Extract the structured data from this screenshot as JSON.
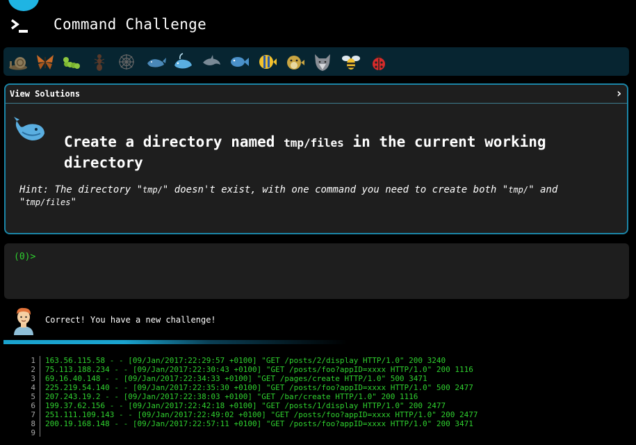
{
  "app": {
    "title": "Command Challenge"
  },
  "levels": [
    {
      "icon": "snail-icon"
    },
    {
      "icon": "butterfly-icon"
    },
    {
      "icon": "caterpillar-icon"
    },
    {
      "icon": "ant-icon"
    },
    {
      "icon": "spider-web-icon"
    },
    {
      "icon": "whale-icon"
    },
    {
      "icon": "whale-spouting-icon"
    },
    {
      "icon": "dolphin-icon"
    },
    {
      "icon": "fish-icon"
    },
    {
      "icon": "tropical-fish-icon"
    },
    {
      "icon": "pufferfish-icon"
    },
    {
      "icon": "wolf-icon"
    },
    {
      "icon": "bee-icon"
    },
    {
      "icon": "ladybug-icon"
    }
  ],
  "challenge": {
    "view_solutions": "View Solutions",
    "title_pre": "Create a directory named ",
    "title_code": "tmp/files",
    "title_post": " in the current working directory",
    "hint_pre": "Hint: The directory \"",
    "hint_code1": "tmp/",
    "hint_mid": "\" doesn't exist, with one command you need to create both \"",
    "hint_code2": "tmp/",
    "hint_mid2": "\" and \"",
    "hint_code3": "tmp/files",
    "hint_post": "\""
  },
  "terminal": {
    "prompt": "(0)>",
    "value": ""
  },
  "feedback": {
    "message": "Correct! You have a new challenge!",
    "progress": 0.55
  },
  "file": {
    "line_numbers": [
      "1",
      "2",
      "3",
      "4",
      "5",
      "6",
      "7",
      "8",
      "9"
    ],
    "lines": [
      "163.56.115.58 - - [09/Jan/2017:22:29:57 +0100] \"GET /posts/2/display HTTP/1.0\" 200 3240",
      "75.113.188.234 - - [09/Jan/2017:22:30:43 +0100] \"GET /posts/foo?appID=xxxx HTTP/1.0\" 200 1116",
      "69.16.40.148 - - [09/Jan/2017:22:34:33 +0100] \"GET /pages/create HTTP/1.0\" 500 3471",
      "225.219.54.140 - - [09/Jan/2017:22:35:30 +0100] \"GET /posts/foo?appID=xxxx HTTP/1.0\" 500 2477",
      "207.243.19.2 - - [09/Jan/2017:22:38:03 +0100] \"GET /bar/create HTTP/1.0\" 200 1116",
      "199.37.62.156 - - [09/Jan/2017:22:42:18 +0100] \"GET /posts/1/display HTTP/1.0\" 200 2477",
      "251.111.109.143 - - [09/Jan/2017:22:49:02 +0100] \"GET /posts/foo?appID=xxxx HTTP/1.0\" 200 2477",
      "200.19.168.148 - - [09/Jan/2017:22:57:11 +0100] \"GET /posts/foo?appID=xxxx HTTP/1.0\" 200 3471",
      ""
    ]
  },
  "colors": {
    "accent": "#1fb4e3",
    "terminal_green": "#2fd12f",
    "panel_bg": "#1e1e1e",
    "level_bar_bg": "#072531"
  }
}
